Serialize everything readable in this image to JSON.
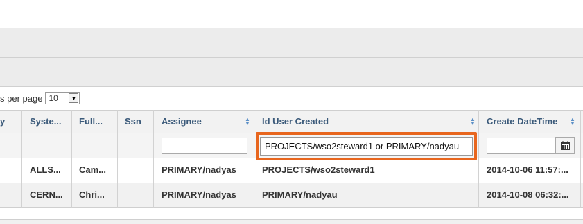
{
  "pager": {
    "label": "s per page",
    "value": "10"
  },
  "columns": [
    {
      "id": "y",
      "label": "y"
    },
    {
      "id": "system",
      "label": "Syste..."
    },
    {
      "id": "full",
      "label": "Full..."
    },
    {
      "id": "ssn",
      "label": "Ssn"
    },
    {
      "id": "assignee",
      "label": "Assignee"
    },
    {
      "id": "id_user_created",
      "label": "Id User Created"
    },
    {
      "id": "create_datetime",
      "label": "Create DateTime"
    }
  ],
  "filters": {
    "assignee": "",
    "id_user_created": "PROJECTS/wso2steward1 or PRIMARY/nadyau",
    "create_datetime": ""
  },
  "rows": [
    {
      "system": "ALLS...",
      "full": "Cam...",
      "ssn": "",
      "assignee": "PRIMARY/nadyas",
      "id_user_created": "PROJECTS/wso2steward1",
      "create_datetime": "2014-10-06 11:57:..."
    },
    {
      "system": "CERN...",
      "full": "Chri...",
      "ssn": "",
      "assignee": "PRIMARY/nadyas",
      "id_user_created": "PRIMARY/nadyau",
      "create_datetime": "2014-10-08 06:32:..."
    }
  ],
  "icons": {
    "calendar": "calendar-icon",
    "sort": "sort-icon",
    "dropdown": "chevron-down-icon"
  },
  "colors": {
    "highlight": "#e8661e",
    "header_text": "#3b5a7a",
    "sort_icon": "#5a8ec6"
  }
}
